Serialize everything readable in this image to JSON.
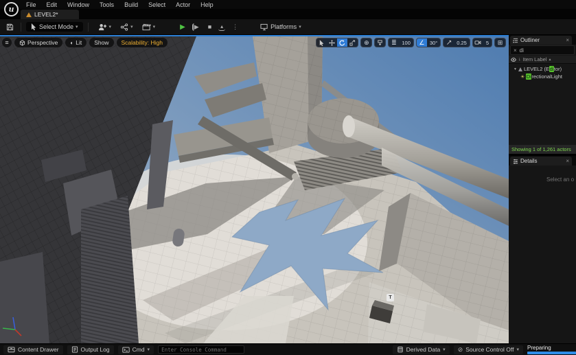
{
  "menu_bar": {
    "items": [
      "File",
      "Edit",
      "Window",
      "Tools",
      "Build",
      "Select",
      "Actor",
      "Help"
    ]
  },
  "level_tab": {
    "label": "LEVEL2*"
  },
  "toolbar": {
    "select_mode_label": "Select Mode",
    "platforms_label": "Platforms"
  },
  "viewport_overlay": {
    "perspective_label": "Perspective",
    "lit_label": "Lit",
    "show_label": "Show",
    "scalability_label": "Scalability: High",
    "grid_snap_value": "100",
    "angle_snap_value": "30°",
    "scale_snap_value": "0.25",
    "camera_speed_value": "5",
    "sprite_glyph": "T"
  },
  "outliner": {
    "tab_label": "Outliner",
    "search_text": "di",
    "column_header": "Item Label",
    "rows": [
      {
        "pre": "LEVEL2 (E",
        "match": "di",
        "post": "tor)"
      },
      {
        "pre": "",
        "match": "Di",
        "post": "rectionalLight"
      }
    ],
    "footer": "Showing 1 of 1,261 actors"
  },
  "details": {
    "tab_label": "Details",
    "empty_text": "Select an o"
  },
  "status_bar": {
    "content_drawer_label": "Content Drawer",
    "output_log_label": "Output Log",
    "cmd_label": "Cmd",
    "console_placeholder": "Enter Console Command",
    "derived_data_label": "Derived Data",
    "source_control_label": "Source Control Off",
    "progress_label": "Preparing"
  },
  "glyphs": {
    "logo": "u",
    "close": "×",
    "chevron_down": "▾",
    "dots": "⋮",
    "sort_asc": "▴",
    "expander": "▼",
    "play": "▶",
    "step": "▶",
    "stop": "■",
    "eject": "▴",
    "hamburger": "≡",
    "lit": "◐",
    "globe": "⊕",
    "grid_lines": "≣",
    "angle": "∠",
    "maximize": "⊞",
    "slash_circle": "⊘",
    "pin_down": "↓",
    "sun": "☀"
  },
  "colors": {
    "accent_blue": "#2f7cd6",
    "match_green": "#58c02c",
    "scalability_amber": "#f0b132",
    "footer_green": "#7fd84f",
    "progress_blue": "#2e8de8"
  }
}
